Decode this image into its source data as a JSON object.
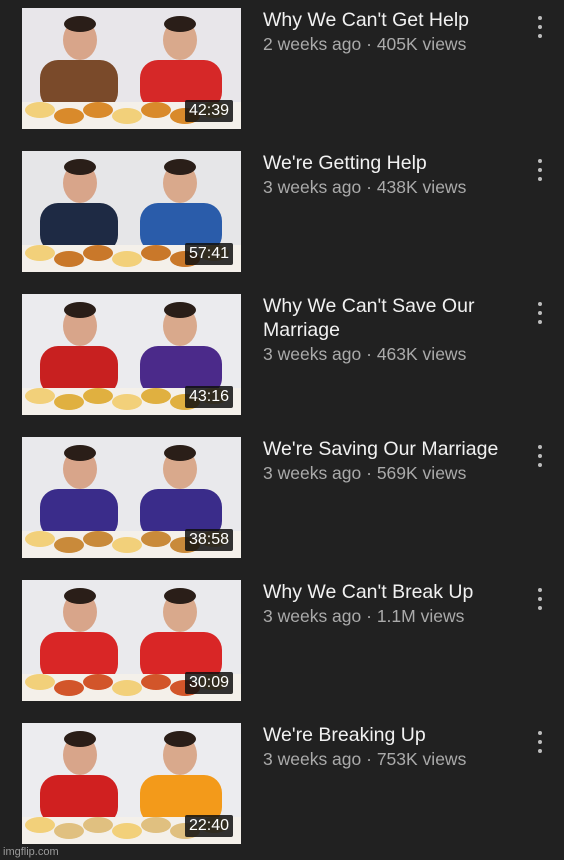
{
  "videos": [
    {
      "title": "Why We Can't Get Help",
      "age": "2 weeks ago",
      "views": "405K views",
      "duration": "42:39",
      "palette": {
        "bg": "#e8e6ea",
        "left_shirt": "#7a4a2a",
        "right_shirt": "#d62828",
        "food": "#d98a2b"
      }
    },
    {
      "title": "We're Getting Help",
      "age": "3 weeks ago",
      "views": "438K views",
      "duration": "57:41",
      "palette": {
        "bg": "#e6e6e8",
        "left_shirt": "#1e2a44",
        "right_shirt": "#2a5caa",
        "food": "#c9782a"
      }
    },
    {
      "title": "Why We Can't Save Our Marriage",
      "age": "3 weeks ago",
      "views": "463K views",
      "duration": "43:16",
      "palette": {
        "bg": "#ebebee",
        "left_shirt": "#c82020",
        "right_shirt": "#4b2a8a",
        "food": "#e0b040"
      }
    },
    {
      "title": "We're Saving Our Marriage",
      "age": "3 weeks ago",
      "views": "569K views",
      "duration": "38:58",
      "palette": {
        "bg": "#e9e9ec",
        "left_shirt": "#3a2c8a",
        "right_shirt": "#3a2c8a",
        "food": "#c98a3a"
      }
    },
    {
      "title": "Why We Can't Break Up",
      "age": "3 weeks ago",
      "views": "1.1M views",
      "duration": "30:09",
      "palette": {
        "bg": "#eaeaed",
        "left_shirt": "#d92626",
        "right_shirt": "#d92626",
        "food": "#d2552a"
      }
    },
    {
      "title": "We're Breaking Up",
      "age": "3 weeks ago",
      "views": "753K views",
      "duration": "22:40",
      "palette": {
        "bg": "#ececef",
        "left_shirt": "#d02020",
        "right_shirt": "#f39a1a",
        "food": "#e0c080"
      }
    }
  ],
  "separator": " · ",
  "watermark": "imgflip.com"
}
